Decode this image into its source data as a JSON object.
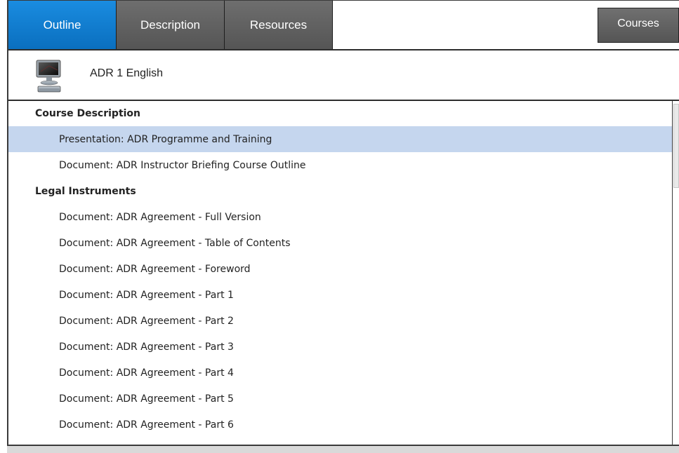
{
  "tabs": {
    "outline": "Outline",
    "description": "Description",
    "resources": "Resources"
  },
  "courses_label": "Courses",
  "course": {
    "title": "ADR 1 English",
    "icon": "computer-icon"
  },
  "sections": [
    {
      "title": "Course Description",
      "items": [
        {
          "label": "Presentation: ADR Programme and Training",
          "selected": true
        },
        {
          "label": "Document: ADR Instructor Briefing Course Outline",
          "selected": false
        }
      ]
    },
    {
      "title": "Legal Instruments",
      "items": [
        {
          "label": "Document: ADR Agreement - Full Version",
          "selected": false
        },
        {
          "label": "Document: ADR Agreement - Table of Contents",
          "selected": false
        },
        {
          "label": "Document: ADR Agreement - Foreword",
          "selected": false
        },
        {
          "label": "Document: ADR Agreement - Part 1",
          "selected": false
        },
        {
          "label": "Document: ADR Agreement - Part 2",
          "selected": false
        },
        {
          "label": "Document: ADR Agreement - Part 3",
          "selected": false
        },
        {
          "label": "Document: ADR Agreement - Part 4",
          "selected": false
        },
        {
          "label": "Document: ADR Agreement - Part 5",
          "selected": false
        },
        {
          "label": "Document: ADR Agreement - Part 6",
          "selected": false
        }
      ]
    }
  ],
  "colors": {
    "active_tab": "#0a7fd6",
    "inactive_tab": "#5f5f5f",
    "selected_row": "#c5d6ee"
  }
}
